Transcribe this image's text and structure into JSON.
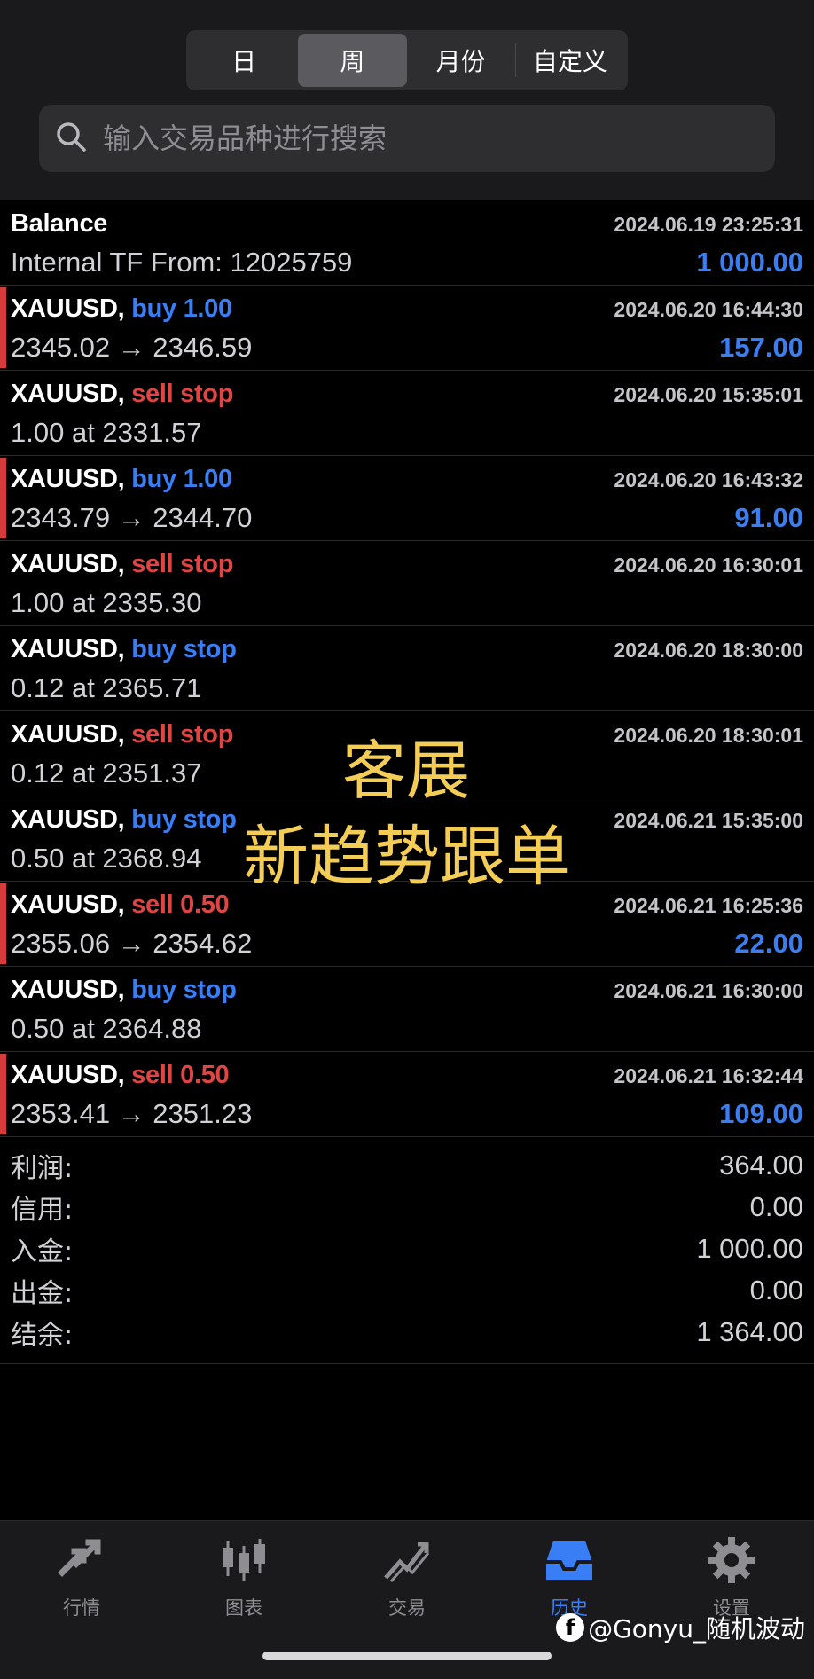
{
  "period_tabs": [
    {
      "label": "日",
      "active": false
    },
    {
      "label": "周",
      "active": true
    },
    {
      "label": "月份",
      "active": false
    },
    {
      "label": "自定义",
      "active": false
    }
  ],
  "search": {
    "placeholder": "输入交易品种进行搜索"
  },
  "balance_row": {
    "title": "Balance",
    "time": "2024.06.19 23:25:31",
    "detail": "Internal TF From: 12025759",
    "amount": "1 000.00"
  },
  "trades": [
    {
      "symbol": "XAUUSD,",
      "action": "buy 1.00",
      "side": "buy",
      "time": "2024.06.20 16:44:30",
      "detail": "2345.02 → 2346.59",
      "amount": "157.00",
      "marked": true
    },
    {
      "symbol": "XAUUSD,",
      "action": "sell stop",
      "side": "sell",
      "time": "2024.06.20 15:35:01",
      "detail": "1.00 at 2331.57",
      "amount": "",
      "marked": false
    },
    {
      "symbol": "XAUUSD,",
      "action": "buy 1.00",
      "side": "buy",
      "time": "2024.06.20 16:43:32",
      "detail": "2343.79 → 2344.70",
      "amount": "91.00",
      "marked": true
    },
    {
      "symbol": "XAUUSD,",
      "action": "sell stop",
      "side": "sell",
      "time": "2024.06.20 16:30:01",
      "detail": "1.00 at 2335.30",
      "amount": "",
      "marked": false
    },
    {
      "symbol": "XAUUSD,",
      "action": "buy stop",
      "side": "buy",
      "time": "2024.06.20 18:30:00",
      "detail": "0.12 at 2365.71",
      "amount": "",
      "marked": false
    },
    {
      "symbol": "XAUUSD,",
      "action": "sell stop",
      "side": "sell",
      "time": "2024.06.20 18:30:01",
      "detail": "0.12 at 2351.37",
      "amount": "",
      "marked": false
    },
    {
      "symbol": "XAUUSD,",
      "action": "buy stop",
      "side": "buy",
      "time": "2024.06.21 15:35:00",
      "detail": "0.50 at 2368.94",
      "amount": "",
      "marked": false
    },
    {
      "symbol": "XAUUSD,",
      "action": "sell 0.50",
      "side": "sell",
      "time": "2024.06.21 16:25:36",
      "detail": "2355.06 → 2354.62",
      "amount": "22.00",
      "marked": true
    },
    {
      "symbol": "XAUUSD,",
      "action": "buy stop",
      "side": "buy",
      "time": "2024.06.21 16:30:00",
      "detail": "0.50 at 2364.88",
      "amount": "",
      "marked": false
    },
    {
      "symbol": "XAUUSD,",
      "action": "sell 0.50",
      "side": "sell",
      "time": "2024.06.21 16:32:44",
      "detail": "2353.41 → 2351.23",
      "amount": "109.00",
      "marked": true
    }
  ],
  "overlay": {
    "line1": "客展",
    "line2": "新趋势跟单",
    "color": "#f3cd55"
  },
  "summary": [
    {
      "label": "利润:",
      "value": "364.00"
    },
    {
      "label": "信用:",
      "value": "0.00"
    },
    {
      "label": "入金:",
      "value": "1 000.00"
    },
    {
      "label": "出金:",
      "value": "0.00"
    },
    {
      "label": "结余:",
      "value": "1 364.00"
    }
  ],
  "tabbar": [
    {
      "label": "行情",
      "icon": "quotes-arrows-icon",
      "active": false
    },
    {
      "label": "图表",
      "icon": "candlestick-chart-icon",
      "active": false
    },
    {
      "label": "交易",
      "icon": "trade-chart-icon",
      "active": false
    },
    {
      "label": "历史",
      "icon": "history-inbox-icon",
      "active": true
    },
    {
      "label": "设置",
      "icon": "gear-icon",
      "active": false
    }
  ],
  "credit": {
    "text": "@Gonyu_随机波动",
    "logo": "f"
  },
  "colors": {
    "buy": "#3a7ef5",
    "sell": "#e04545",
    "marker": "#d63b3b",
    "accent": "#3a7ef5"
  }
}
